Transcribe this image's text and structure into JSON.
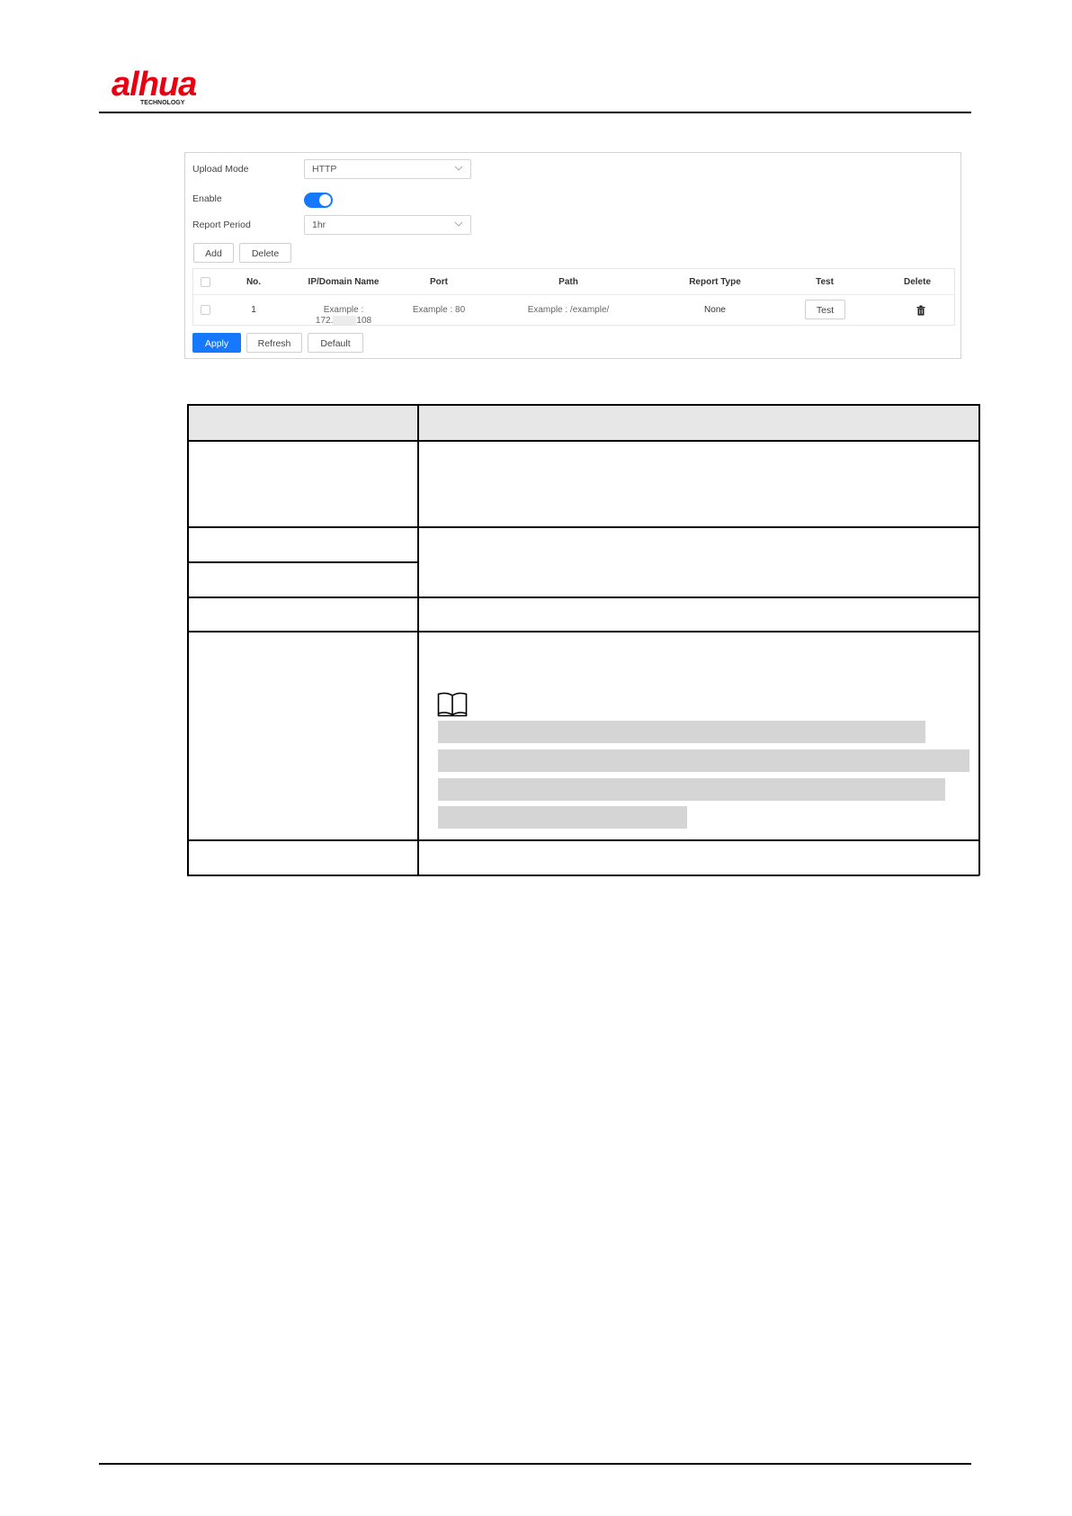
{
  "brand": {
    "logo_text": "alhua",
    "logo_sub": "TECHNOLOGY",
    "accent_color": "#e60012"
  },
  "form": {
    "upload_mode": {
      "label": "Upload Mode",
      "value": "HTTP"
    },
    "enable": {
      "label": "Enable",
      "on": true
    },
    "report_period": {
      "label": "Report Period",
      "value": "1hr"
    },
    "add_label": "Add",
    "delete_label": "Delete"
  },
  "server_table": {
    "headers": [
      "No.",
      "IP/Domain Name",
      "Port",
      "Path",
      "Report Type",
      "Test",
      "Delete"
    ],
    "rows": [
      {
        "no": "1",
        "ip_line1": "Example :",
        "ip_prefix": "172.",
        "ip_suffix": "108",
        "port": "Example : 80",
        "path": "Example : /example/",
        "report_type": "None",
        "test_label": "Test"
      }
    ]
  },
  "footer_buttons": {
    "apply": "Apply",
    "refresh": "Refresh",
    "default": "Default"
  },
  "colors": {
    "primary": "#1677ff",
    "header_fill": "#e7e7e7",
    "redaction": "#d5d5d5"
  }
}
